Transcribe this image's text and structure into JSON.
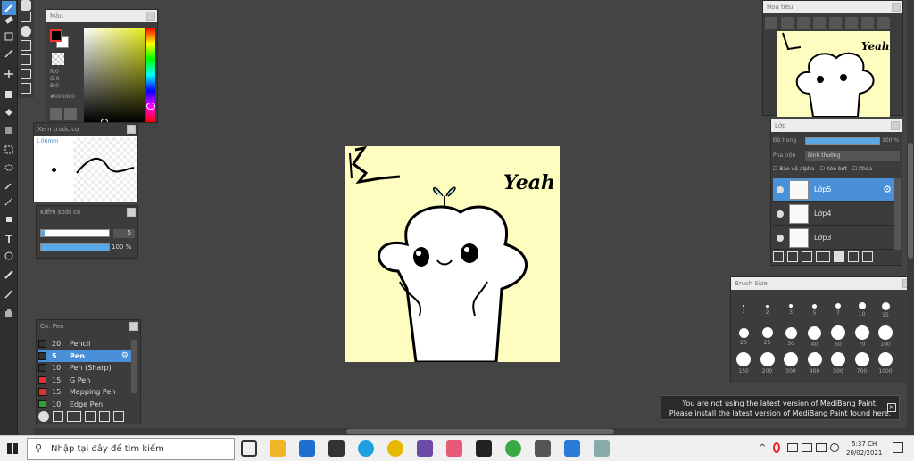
{
  "color_panel": {
    "title": "Màu",
    "r": "R:0",
    "g": "G:0",
    "b": "B:0",
    "hex": "#000000"
  },
  "brush_preview": {
    "title": "Xem trước cọ",
    "size": "1.06mm"
  },
  "brush_control": {
    "title": "Kiểm soát cọ",
    "size_value": "5",
    "opacity_value": "100 %",
    "size_fraction": 0.05,
    "opacity_fraction": 1.0
  },
  "brush_list": {
    "title": "Cọ: Pen",
    "items": [
      {
        "size": "20",
        "name": "Pencil",
        "color": "#333333"
      },
      {
        "size": "5",
        "name": "Pen",
        "color": "#333333",
        "selected": true
      },
      {
        "size": "10",
        "name": "Pen (Sharp)",
        "color": "#333333"
      },
      {
        "size": "15",
        "name": "G Pen",
        "color": "#e03030"
      },
      {
        "size": "15",
        "name": "Mapping Pen",
        "color": "#e03030"
      },
      {
        "size": "10",
        "name": "Edge Pen",
        "color": "#30a030"
      }
    ]
  },
  "navigator": {
    "title": "Hoa tiêu"
  },
  "canvas": {
    "text_yeah": "Yeah",
    "background": "#fdfdc0"
  },
  "layer_panel": {
    "title": "Lớp",
    "opacity_label": "Độ trong",
    "opacity_value": "100 %",
    "blend_label": "Pha trộn",
    "blend_value": "Bình thường",
    "protect_alpha": "Bảo vệ alpha",
    "clip": "Xén bớt",
    "lock": "Khóa",
    "layers": [
      {
        "name": "Lớp5",
        "selected": true
      },
      {
        "name": "Lớp4"
      },
      {
        "name": "Lớp3"
      }
    ]
  },
  "brush_size": {
    "title": "Brush Size",
    "sizes": [
      "1",
      "2",
      "3",
      "5",
      "7",
      "10",
      "15",
      "20",
      "25",
      "30",
      "40",
      "50",
      "70",
      "100",
      "150",
      "200",
      "300",
      "400",
      "500",
      "700",
      "1000"
    ]
  },
  "notice": {
    "line1": "You are not using the latest version of MediBang Paint.",
    "line2": "Please install the latest version of MediBang Paint found here."
  },
  "taskbar": {
    "search_placeholder": "Nhập tại đây để tìm kiếm",
    "time": "5:37 CH",
    "date": "20/02/2021"
  },
  "colors": {
    "accent": "#4a90d9",
    "panel_bg": "#3c3c3c",
    "workspace": "#444444"
  }
}
